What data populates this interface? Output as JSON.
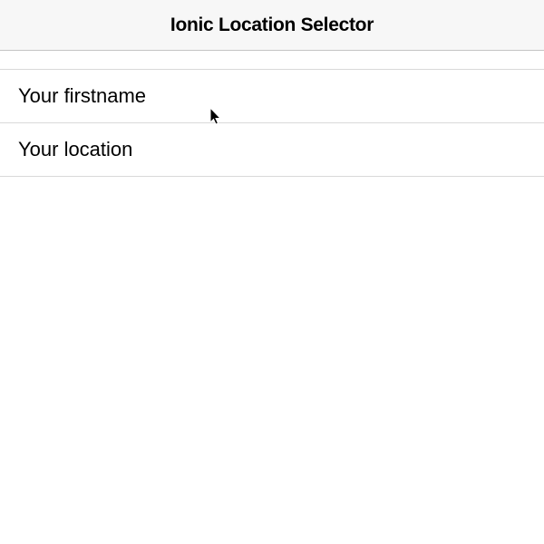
{
  "header": {
    "title": "Ionic Location Selector"
  },
  "form": {
    "firstname": {
      "placeholder": "Your firstname",
      "value": ""
    },
    "location": {
      "placeholder": "Your location",
      "value": ""
    }
  }
}
